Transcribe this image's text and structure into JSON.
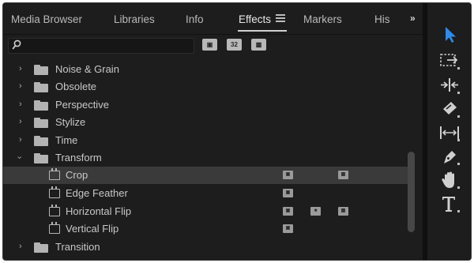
{
  "tabs": [
    {
      "label": "Media Browser"
    },
    {
      "label": "Libraries"
    },
    {
      "label": "Info"
    },
    {
      "label": "Effects",
      "active": true
    },
    {
      "label": "Markers"
    },
    {
      "label": "His"
    }
  ],
  "tab_overflow": "»",
  "search": {
    "value": "",
    "placeholder": ""
  },
  "filters": [
    "32"
  ],
  "tree": [
    {
      "label": "Noise & Grain",
      "type": "folder",
      "expanded": false
    },
    {
      "label": "Obsolete",
      "type": "folder",
      "expanded": false
    },
    {
      "label": "Perspective",
      "type": "folder",
      "expanded": false
    },
    {
      "label": "Stylize",
      "type": "folder",
      "expanded": false
    },
    {
      "label": "Time",
      "type": "folder",
      "expanded": false
    },
    {
      "label": "Transform",
      "type": "folder",
      "expanded": true
    },
    {
      "label": "Crop",
      "type": "effect",
      "selected": true
    },
    {
      "label": "Edge Feather",
      "type": "effect"
    },
    {
      "label": "Horizontal Flip",
      "type": "effect"
    },
    {
      "label": "Vertical Flip",
      "type": "effect"
    },
    {
      "label": "Transition",
      "type": "folder",
      "expanded": false
    }
  ],
  "tools": [
    {
      "name": "selection-tool",
      "icon": "arrow-icon",
      "selected": true
    },
    {
      "name": "track-select-tool",
      "icon": "track-select-icon"
    },
    {
      "name": "ripple-edit-tool",
      "icon": "ripple-edit-icon"
    },
    {
      "name": "razor-tool",
      "icon": "razor-icon"
    },
    {
      "name": "slip-tool",
      "icon": "slip-icon"
    },
    {
      "name": "pen-tool",
      "icon": "pen-icon"
    },
    {
      "name": "hand-tool",
      "icon": "hand-icon"
    },
    {
      "name": "type-tool",
      "icon": "type-icon"
    }
  ],
  "colors": {
    "accent": "#2d8ceb",
    "panel": "#1d1d1d",
    "selected_row": "#3a3a3a"
  }
}
